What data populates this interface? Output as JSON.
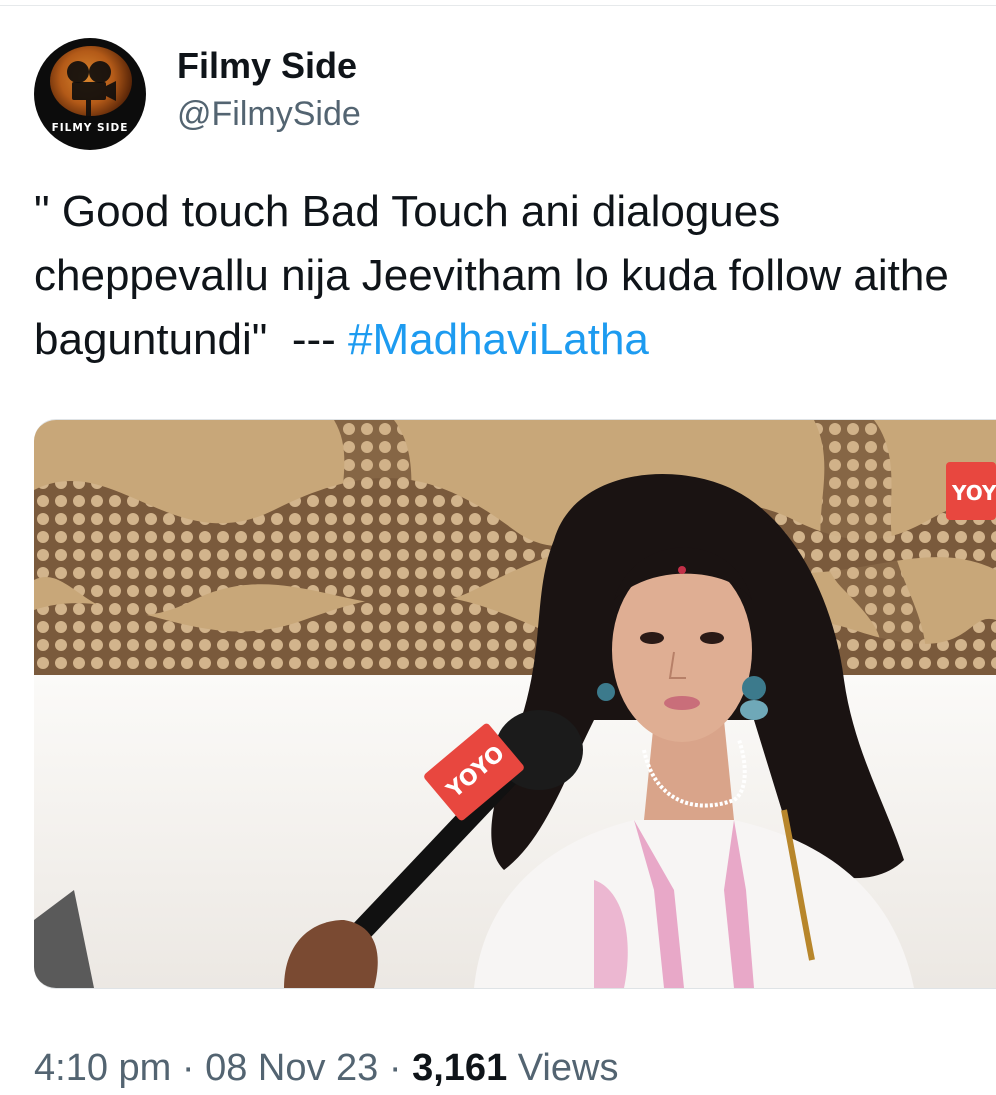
{
  "tweet": {
    "author": {
      "display_name": "Filmy Side",
      "handle": "@FilmySide",
      "avatar_text": "FILMY SIDE"
    },
    "text": "\" Good touch Bad Touch ani dialogues cheppevallu nija Jeevitham lo kuda follow aithe baguntundi\"  --- ",
    "hashtag": "#MadhaviLatha",
    "media": {
      "description": "photo",
      "mic_logo_text": "YOYO",
      "watermark_text": "YOY"
    },
    "time": "4:10 pm",
    "separator": " · ",
    "date": "08 Nov 23",
    "views_count": "3,161",
    "views_label": " Views"
  },
  "colors": {
    "text": "#0f1419",
    "secondary_text": "#536471",
    "hashtag": "#1d9bf0",
    "logo_red": "#e8473f"
  }
}
